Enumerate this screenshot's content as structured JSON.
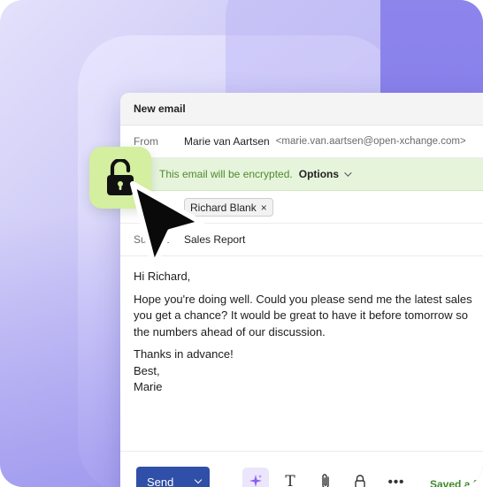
{
  "colors": {
    "send_button": "#2f4fa8",
    "encryption_banner_bg": "#e6f4dc",
    "encryption_text": "#4f8a2f",
    "lock_badge_bg": "#d3ef9f",
    "saved_text": "#3f8a2a"
  },
  "window": {
    "title": "New email"
  },
  "from": {
    "label": "From",
    "name": "Marie van Aartsen",
    "email": "<marie.van.aartsen@open-xchange.com>"
  },
  "encryption": {
    "message": "This email will be encrypted.",
    "options_label": "Options"
  },
  "to": {
    "recipient": "Richard Blank",
    "remove_glyph": "×"
  },
  "subject": {
    "label": "Subject",
    "value": "Sales Report"
  },
  "body": {
    "greeting": "Hi Richard,",
    "line1": "Hope you're doing well. Could you please send me the latest sales",
    "line2": "you get a chance? It would be great to have it before tomorrow so",
    "line3": "the numbers ahead of our discussion.",
    "closing1": "Thanks in advance!",
    "closing2": "Best,",
    "signature": "Marie"
  },
  "toolbar": {
    "send_label": "Send",
    "text_format_glyph": "T",
    "more_glyph": "•••",
    "saved_status": "Saved a f",
    "icons": [
      "chevron-down-icon",
      "ai-sparkle-icon",
      "text-format-icon",
      "paperclip-icon",
      "lock-icon",
      "more-icon"
    ]
  },
  "overlay": {
    "icons": [
      "unlocked-padlock-icon",
      "mouse-pointer-icon"
    ]
  }
}
